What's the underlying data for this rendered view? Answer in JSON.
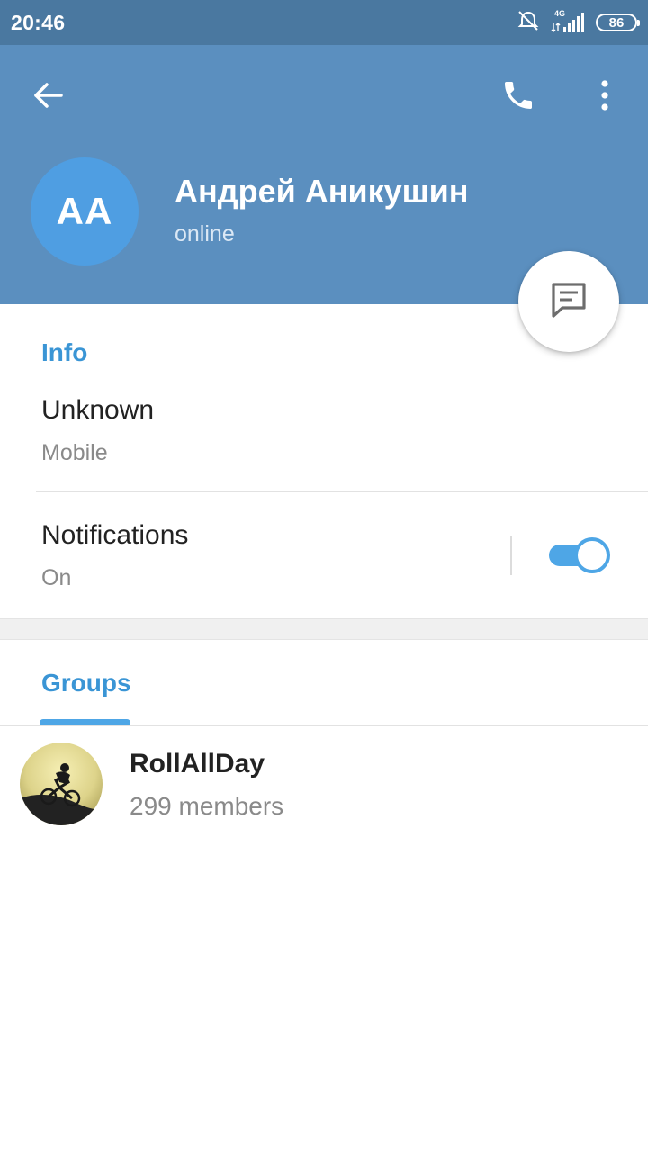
{
  "status_bar": {
    "time": "20:46",
    "network": "4G",
    "battery": "86",
    "icons": [
      "alarm-off-icon",
      "signal-icon",
      "battery-icon"
    ]
  },
  "header": {
    "icons": [
      "back-arrow-icon",
      "phone-icon",
      "more-vert-icon"
    ],
    "avatar_initials": "AA",
    "name": "Андрей Аникушин",
    "status": "online",
    "fab_icon": "message-icon"
  },
  "info": {
    "section_title": "Info",
    "phone_value": "Unknown",
    "phone_label": "Mobile",
    "notifications_label": "Notifications",
    "notifications_value": "On",
    "notifications_enabled": true
  },
  "groups": {
    "section_title": "Groups",
    "items": [
      {
        "name": "RollAllDay",
        "members": "299 members"
      }
    ]
  },
  "colors": {
    "status_bar": "#4a78a0",
    "header": "#5b8fbf",
    "accent": "#3a95d5",
    "avatar": "#4f9ee2",
    "toggle": "#4ea6e6"
  }
}
